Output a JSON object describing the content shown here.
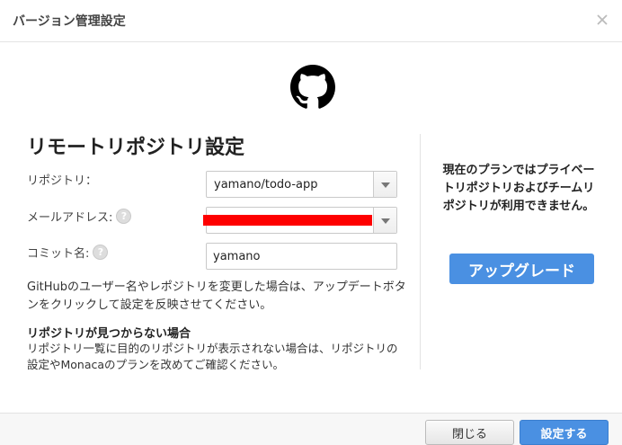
{
  "dialog": {
    "title": "バージョン管理設定"
  },
  "icons": {
    "logo": "github-icon",
    "close": "close-icon",
    "help": "help-icon",
    "dropdown": "chevron-down-icon"
  },
  "main": {
    "heading": "リモートリポジトリ設定",
    "repository": {
      "label": "リポジトリ：",
      "value": "yamano/todo-app"
    },
    "email": {
      "label": "メールアドレス:",
      "help": "?"
    },
    "commit_name": {
      "label": "コミット名:",
      "help": "?",
      "value": "yamano"
    },
    "description": "GitHubのユーザー名やレポジトリを変更した場合は、アップデートボタンをクリックして設定を反映させてください。",
    "not_found_heading": "リポジトリが見つからない場合",
    "not_found_text": "リポジトリ一覧に目的のリポジトリが表示されない場合は、リポジトリの設定やMonacaのプランを改めてご確認ください。"
  },
  "plan": {
    "notice": "現在のプランではプライベートリポジトリおよびチームリポジトリが利用できません。",
    "upgrade_label": "アップグレード"
  },
  "footer": {
    "close_label": "閉じる",
    "save_label": "設定する"
  },
  "colors": {
    "primary": "#4a90e2",
    "redaction": "#fe0000"
  }
}
